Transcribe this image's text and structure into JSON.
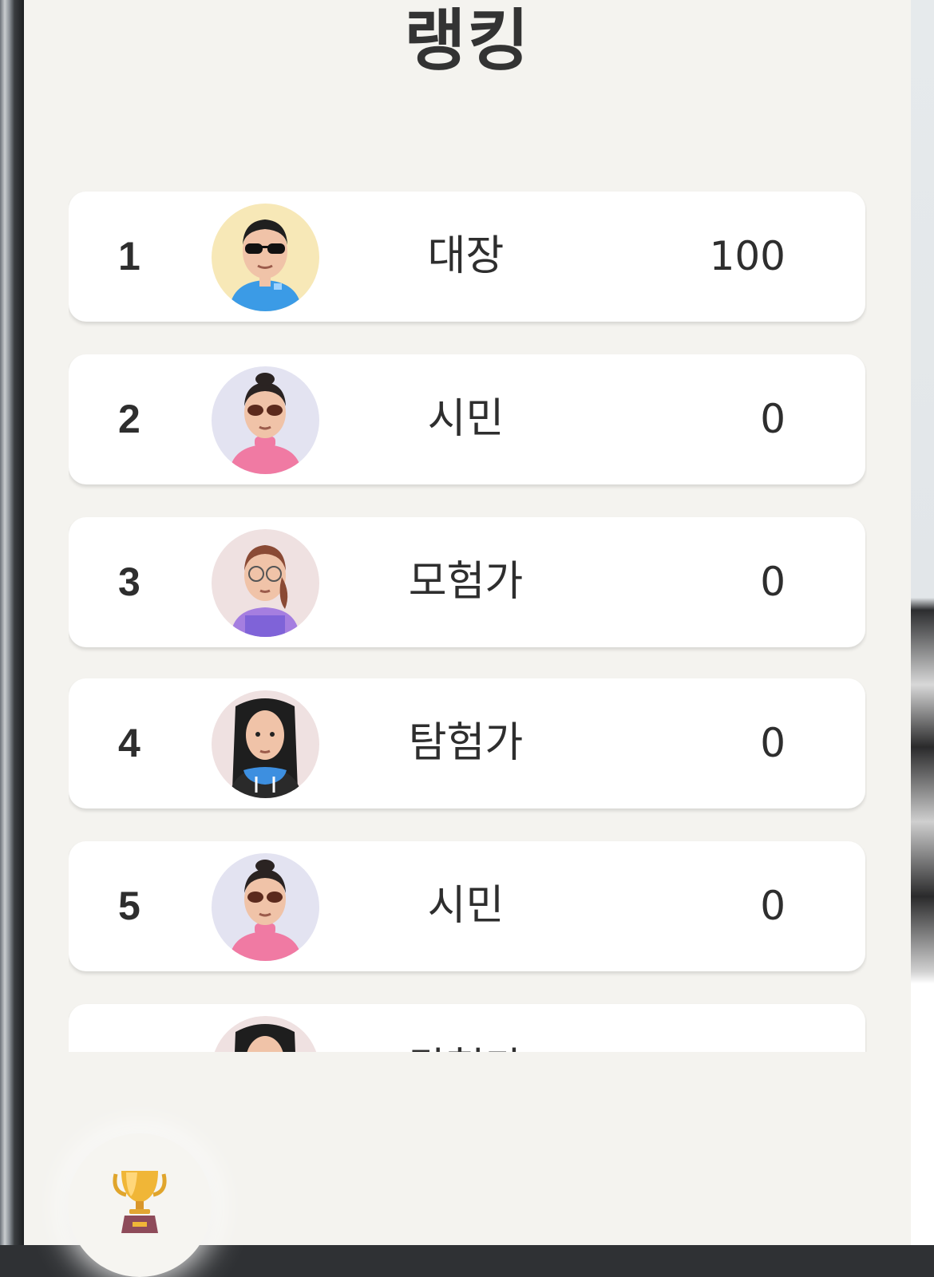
{
  "page": {
    "title": "랭킹"
  },
  "ranking": [
    {
      "rank": "1",
      "name": "대장",
      "score": "100",
      "avatar": "avatar-sunglasses-man-blue-shirt",
      "avatar_bg": "#f7e8b7"
    },
    {
      "rank": "2",
      "name": "시민",
      "score": "0",
      "avatar": "avatar-sunglasses-woman-pink-shirt",
      "avatar_bg": "#e3e3f1"
    },
    {
      "rank": "3",
      "name": "모험가",
      "score": "0",
      "avatar": "avatar-glasses-woman-purple-overalls",
      "avatar_bg": "#efe1e1"
    },
    {
      "rank": "4",
      "name": "탐험가",
      "score": "0",
      "avatar": "avatar-long-hair-black-hoodie",
      "avatar_bg": "#efe1e1"
    },
    {
      "rank": "5",
      "name": "시민",
      "score": "0",
      "avatar": "avatar-sunglasses-woman-pink-shirt",
      "avatar_bg": "#e3e3f1"
    },
    {
      "rank": "",
      "name": "탐험가",
      "score": "",
      "avatar": "avatar-long-hair-black-hoodie",
      "avatar_bg": "#efe1e1"
    }
  ],
  "nav": {
    "trophy_icon": "trophy-icon"
  },
  "colors": {
    "panel_bg": "#f4f3ef",
    "card_bg": "#ffffff",
    "text": "#2e2e2e"
  }
}
